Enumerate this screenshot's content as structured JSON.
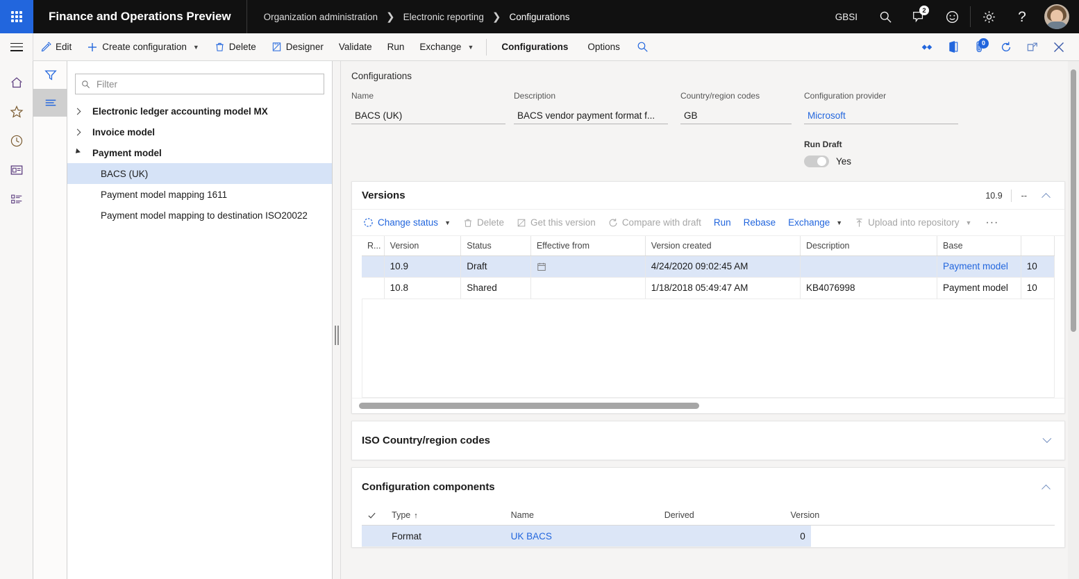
{
  "topbar": {
    "app_launcher": "waffle-icon",
    "app_title": "Finance and Operations Preview",
    "breadcrumbs": [
      "Organization administration",
      "Electronic reporting",
      "Configurations"
    ],
    "company": "GBSI",
    "search_icon": "search-icon",
    "messages_icon": "message-icon",
    "messages_badge": "2",
    "feedback_icon": "smiley-icon",
    "settings_icon": "gear-icon",
    "help_icon": "help-icon",
    "avatar": "user-avatar"
  },
  "actionpane": {
    "nav_toggle": "hamburger-icon",
    "buttons": [
      {
        "label": "Edit",
        "icon": "pencil-icon",
        "dropdown": false
      },
      {
        "label": "Create configuration",
        "icon": "plus-icon",
        "dropdown": true
      },
      {
        "label": "Delete",
        "icon": "trash-icon",
        "dropdown": false
      },
      {
        "label": "Designer",
        "icon": "designer-icon",
        "dropdown": false
      },
      {
        "label": "Validate",
        "icon": "",
        "dropdown": false
      },
      {
        "label": "Run",
        "icon": "",
        "dropdown": false
      },
      {
        "label": "Exchange",
        "icon": "",
        "dropdown": true
      }
    ],
    "tabs": [
      {
        "label": "Configurations",
        "active": true
      },
      {
        "label": "Options",
        "active": false
      }
    ],
    "search_icon": "search-icon",
    "right_icons": [
      "link-share-icon",
      "office-app-icon",
      "attachments-icon",
      "refresh-icon",
      "popout-icon",
      "close-icon"
    ],
    "attachments_badge": "0"
  },
  "navrail": {
    "items": [
      "home-icon",
      "favorites-star-icon",
      "recent-clock-icon",
      "workspaces-icon",
      "modules-list-icon"
    ]
  },
  "filterrail": {
    "items": [
      {
        "icon": "filter-icon",
        "selected": false
      },
      {
        "icon": "list-lines-icon",
        "selected": true
      }
    ]
  },
  "treepanel": {
    "filter_placeholder": "Filter",
    "filter_value": "",
    "search_icon": "search-icon",
    "nodes": [
      {
        "label": "Electronic ledger accounting model MX",
        "level": 0,
        "expanded": false,
        "selected": false
      },
      {
        "label": "Invoice model",
        "level": 0,
        "expanded": false,
        "selected": false
      },
      {
        "label": "Payment model",
        "level": 0,
        "expanded": true,
        "selected": false
      },
      {
        "label": "BACS (UK)",
        "level": 1,
        "expanded": null,
        "selected": true
      },
      {
        "label": "Payment model mapping 1611",
        "level": 1,
        "expanded": null,
        "selected": false
      },
      {
        "label": "Payment model mapping to destination ISO20022",
        "level": 1,
        "expanded": null,
        "selected": false
      }
    ]
  },
  "form": {
    "caption": "Configurations",
    "fields": [
      {
        "label": "Name",
        "value": "BACS (UK)",
        "link": false
      },
      {
        "label": "Description",
        "value": "BACS vendor payment format f...",
        "link": false
      },
      {
        "label": "Country/region codes",
        "value": "GB",
        "link": false
      },
      {
        "label": "Configuration provider",
        "value": "Microsoft",
        "link": true
      }
    ],
    "run_draft": {
      "label": "Run Draft",
      "value": "Yes",
      "on": false
    }
  },
  "versions": {
    "title": "Versions",
    "header_value": "10.9",
    "header_dash": "--",
    "collapse_icon": "chevron-up-icon",
    "toolbar": [
      {
        "label": "Change status",
        "icon": "status-icon",
        "dropdown": true,
        "disabled": false
      },
      {
        "label": "Delete",
        "icon": "trash-icon",
        "dropdown": false,
        "disabled": true
      },
      {
        "label": "Get this version",
        "icon": "get-version-icon",
        "dropdown": false,
        "disabled": true
      },
      {
        "label": "Compare with draft",
        "icon": "compare-icon",
        "dropdown": false,
        "disabled": true
      },
      {
        "label": "Run",
        "icon": "",
        "dropdown": false,
        "disabled": false
      },
      {
        "label": "Rebase",
        "icon": "",
        "dropdown": false,
        "disabled": false
      },
      {
        "label": "Exchange",
        "icon": "",
        "dropdown": true,
        "disabled": false
      },
      {
        "label": "Upload into repository",
        "icon": "upload-icon",
        "dropdown": true,
        "disabled": true
      }
    ],
    "overflow_label": "···",
    "columns": [
      "R...",
      "Version",
      "Status",
      "Effective from",
      "Version created",
      "Description",
      "Base",
      ""
    ],
    "rows": [
      {
        "selected": true,
        "marker": "",
        "version": "10.9",
        "status": "Draft",
        "effective_from": "",
        "effective_from_icon": "calendar-icon",
        "version_created": "4/24/2020 09:02:45 AM",
        "description": "",
        "base": "Payment model",
        "base_link": true,
        "base_version": "10"
      },
      {
        "selected": false,
        "marker": "",
        "version": "10.8",
        "status": "Shared",
        "effective_from": "",
        "effective_from_icon": "",
        "version_created": "1/18/2018 05:49:47 AM",
        "description": "KB4076998",
        "base": "Payment model",
        "base_link": false,
        "base_version": "10"
      }
    ]
  },
  "iso_section": {
    "title": "ISO Country/region codes",
    "expand_icon": "chevron-down-icon"
  },
  "components_section": {
    "title": "Configuration components",
    "collapse_icon": "chevron-up-icon",
    "columns": [
      "",
      "Type",
      "Name",
      "Derived",
      "Version"
    ],
    "sort_column": "Type",
    "sort_arrow": "↑",
    "check_icon": "check-icon",
    "rows": [
      {
        "selected": true,
        "type": "Format",
        "name": "UK BACS",
        "name_link": true,
        "derived": "",
        "version": "0"
      }
    ]
  },
  "scrollbars": {
    "content_vertical": "vertical-scrollbar",
    "versions_horizontal": "horizontal-scrollbar"
  }
}
